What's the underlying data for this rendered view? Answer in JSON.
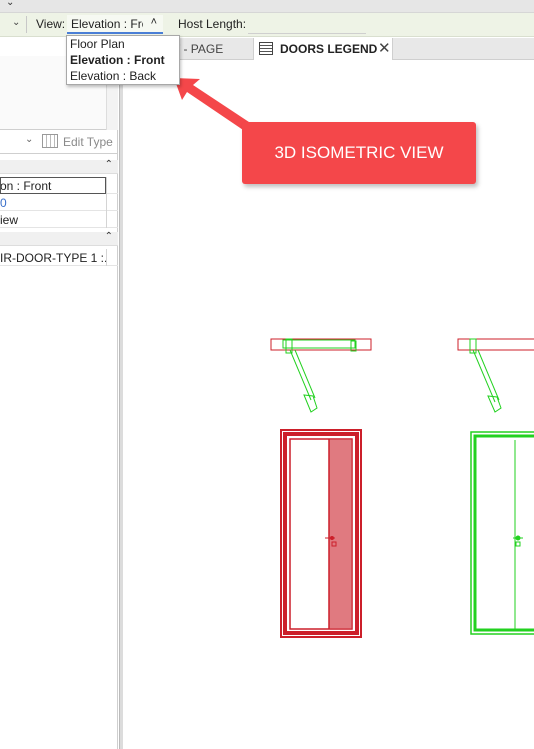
{
  "options_bar": {
    "view_label": "View:",
    "view_value": "Elevation : Front",
    "host_length_label": "Host Length:"
  },
  "view_dropdown": {
    "options": [
      "Floor Plan",
      "Elevation : Front",
      "Elevation : Back"
    ],
    "selected": "Elevation : Front"
  },
  "tabs": [
    {
      "label": "T - PAGE",
      "active": false
    },
    {
      "label": "DOORS LEGEND",
      "active": true
    }
  ],
  "properties": {
    "edit_type_label": "Edit Type",
    "rows": [
      "on : Front",
      "0",
      "iew"
    ],
    "component_row": "IR-DOOR-TYPE 1 :..."
  },
  "annotation": {
    "text": "3D ISOMETRIC VIEW",
    "color": "#f4474a"
  },
  "colors": {
    "door_selected": "#cc1f2a",
    "door_fill": "#e07a80",
    "door_green": "#22d11f"
  },
  "icons": [
    "chevron-down-icon",
    "caret-up-icon",
    "legend-view-icon",
    "close-icon",
    "type-properties-icon",
    "collapse-icon"
  ]
}
